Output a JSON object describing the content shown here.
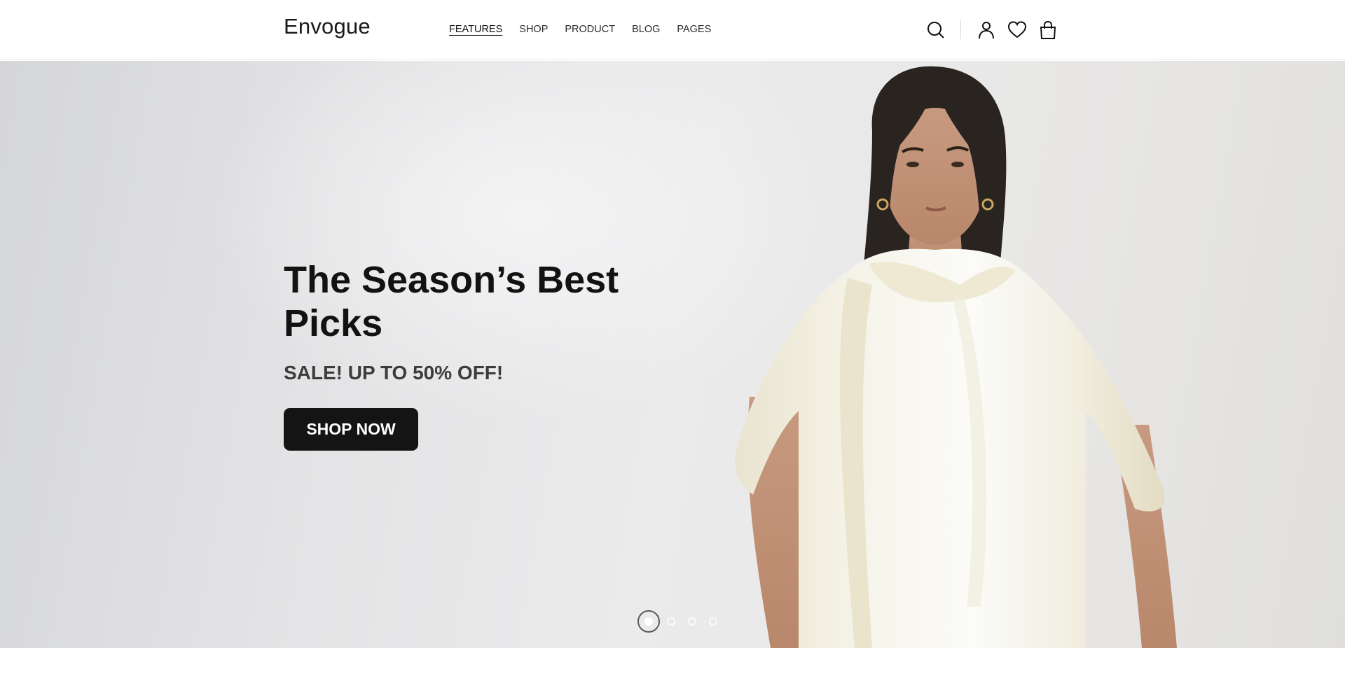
{
  "header": {
    "logo": "Envogue",
    "nav": [
      {
        "label": "FEATURES",
        "active": true
      },
      {
        "label": "SHOP",
        "active": false
      },
      {
        "label": "PRODUCT",
        "active": false
      },
      {
        "label": "BLOG",
        "active": false
      },
      {
        "label": "PAGES",
        "active": false
      }
    ],
    "icons": [
      "search-icon",
      "user-icon",
      "heart-icon",
      "shopping-bag-icon"
    ]
  },
  "hero": {
    "title": "The Season’s Best Picks",
    "subtitle": "SALE! UP TO 50% OFF!",
    "button_label": "SHOP NOW",
    "slides": {
      "count": 4,
      "active_index": 1
    }
  },
  "colors": {
    "button_bg": "#141414",
    "text": "#121212",
    "subtitle": "#3c3c3c"
  }
}
